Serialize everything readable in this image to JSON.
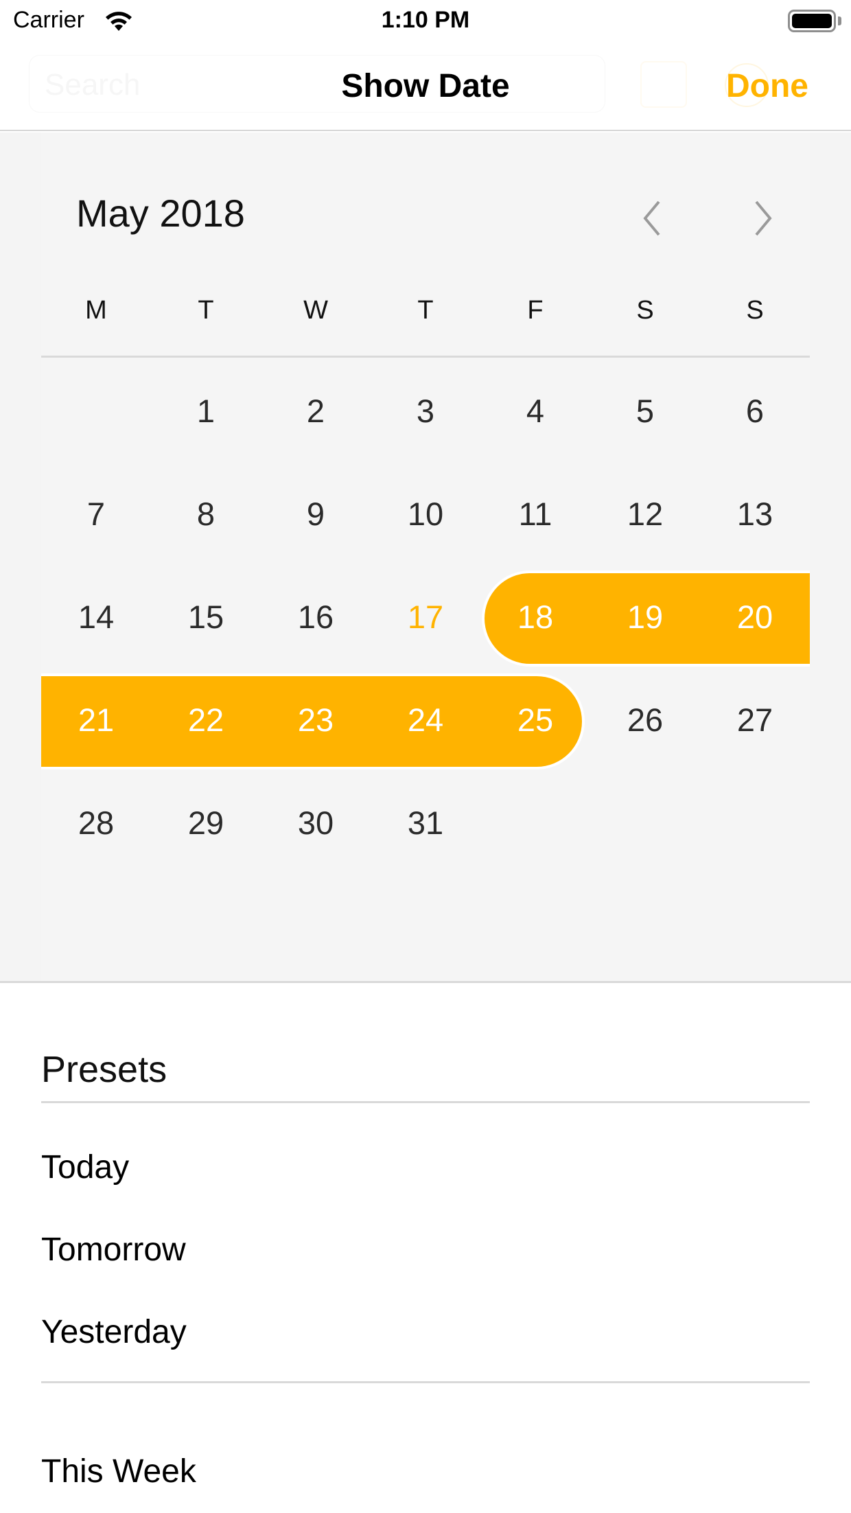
{
  "status_bar": {
    "carrier": "Carrier",
    "time": "1:10 PM",
    "wifi_icon": "wifi-icon",
    "battery_icon": "battery-icon",
    "battery_level": 1.0
  },
  "nav_bar": {
    "ghost_search_placeholder": "Search",
    "title": "Show Date",
    "done_label": "Done"
  },
  "colors": {
    "accent": "#ffb300",
    "calendar_background": "#f5f5f5",
    "day_text": "#2a2a2a",
    "selected_text": "#ffffff",
    "divider": "#d9d9d9"
  },
  "calendar": {
    "month_title": "May 2018",
    "prev_icon": "chevron-left-icon",
    "next_icon": "chevron-right-icon",
    "weekdays": [
      "M",
      "T",
      "W",
      "T",
      "F",
      "S",
      "S"
    ],
    "first_weekday_offset": 1,
    "days_in_month": 31,
    "today": 17,
    "selected_range": {
      "start": 18,
      "end": 25
    }
  },
  "presets": {
    "heading": "Presets",
    "groups": [
      [
        "Today",
        "Tomorrow",
        "Yesterday"
      ],
      [
        "This Week"
      ]
    ]
  }
}
